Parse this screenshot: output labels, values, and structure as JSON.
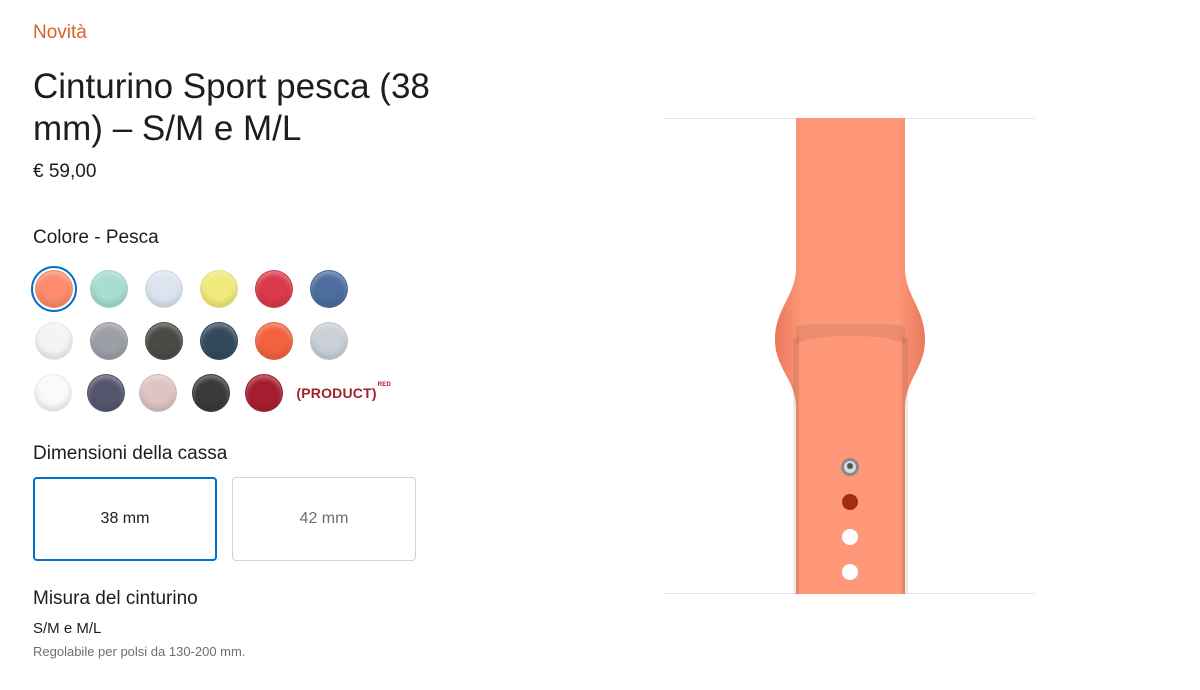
{
  "header": {
    "eyebrow": "Novità",
    "title": "Cinturino Sport pesca (38 mm) – S/M e M/L",
    "price": "€ 59,00"
  },
  "color": {
    "label": "Colore - Pesca",
    "selected_index": 0,
    "swatch_rows": [
      [
        "#fd8b6c",
        "#a6ded0",
        "#dce5ef",
        "#f1ea7c",
        "#da3a4a",
        "#4c6d9e"
      ],
      [
        "#f4f4f2",
        "#9d9fa7",
        "#4b4a47",
        "#344a5c",
        "#f3623f",
        "#c9d0d6"
      ],
      [
        "#fafafa",
        "#55566d",
        "#dfc4c4",
        "#3a3a3a",
        "#a51e30"
      ]
    ],
    "product_red": {
      "label": "(PRODUCT)",
      "superscript": "RED"
    }
  },
  "case_size": {
    "label": "Dimensioni della cassa",
    "options": [
      "38 mm",
      "42 mm"
    ],
    "selected_index": 0
  },
  "band": {
    "label": "Misura del cinturino",
    "size": "S/M e M/L",
    "note": "Regolabile per polsi da 130-200 mm."
  },
  "image": {
    "band_color": "#ff9878",
    "pin_hole_color": "#a32d12"
  }
}
